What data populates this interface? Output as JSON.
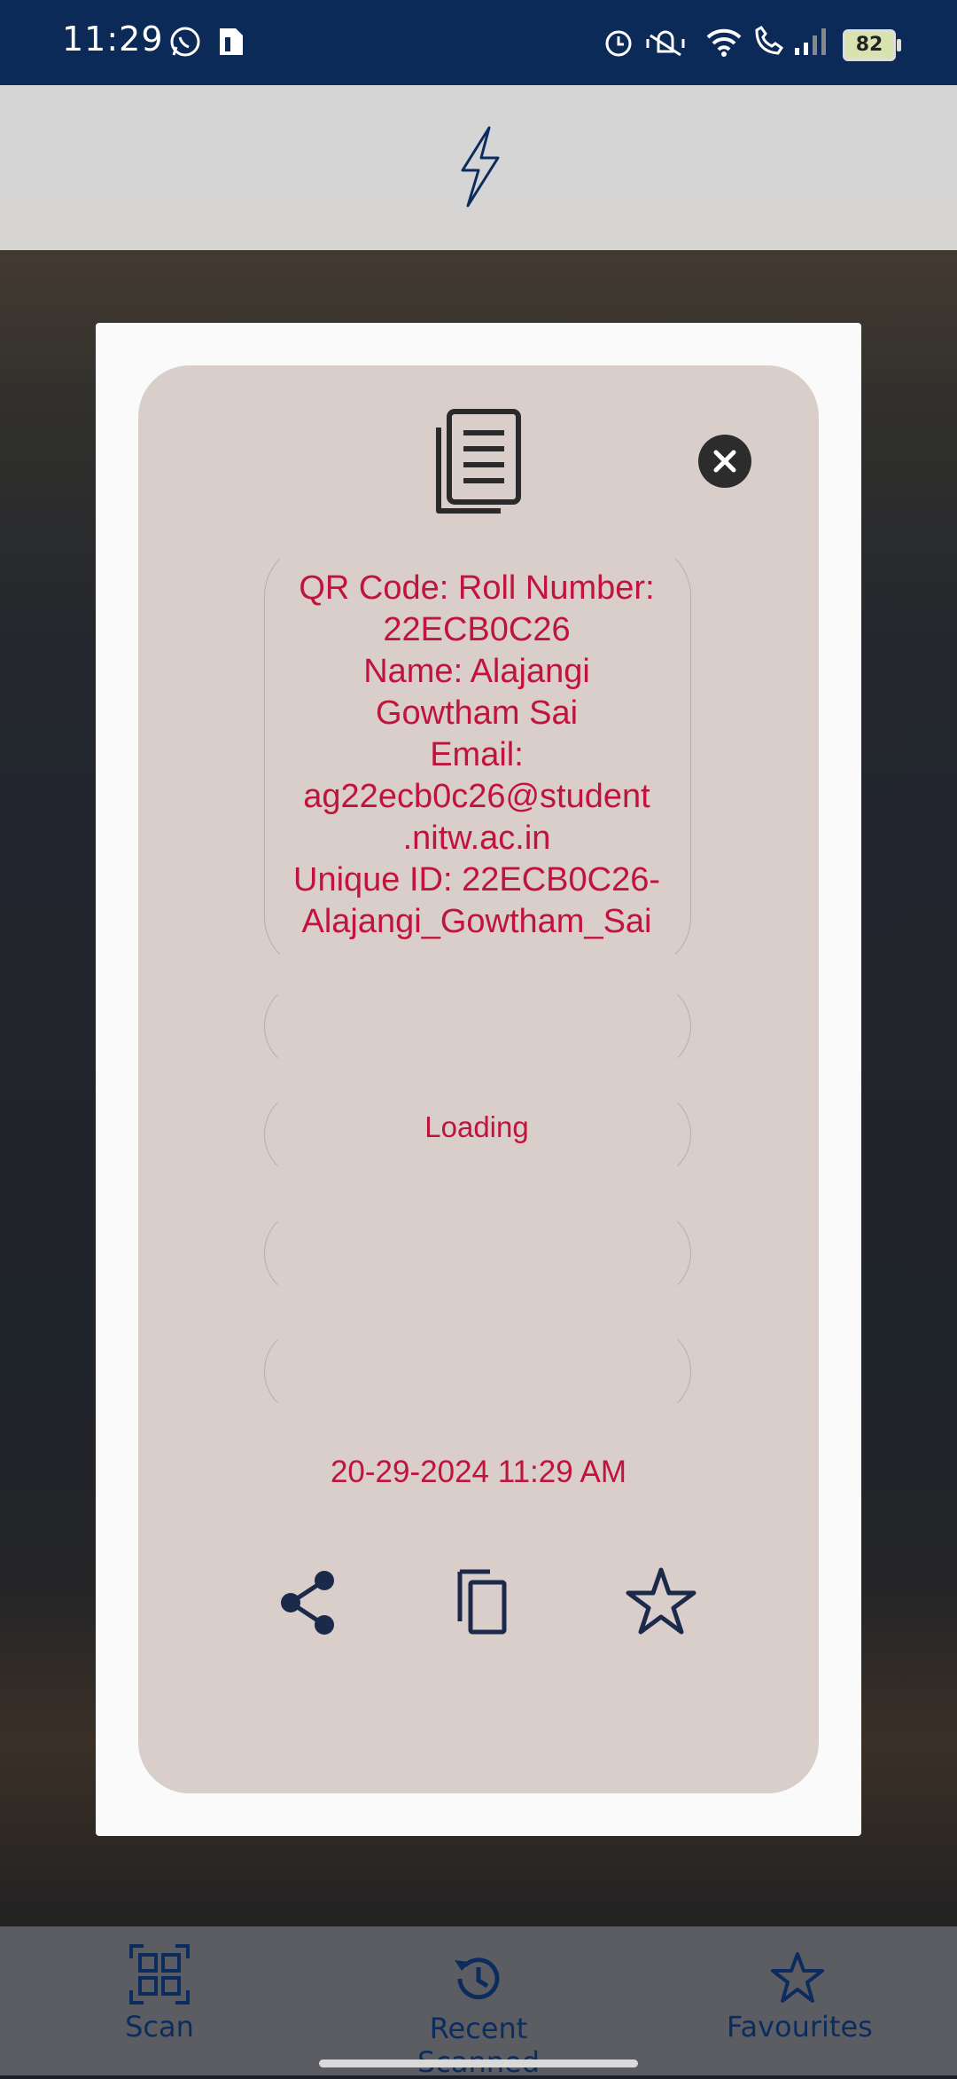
{
  "status_bar": {
    "time": "11:29",
    "battery_level": "82",
    "icons": [
      "whatsapp-icon",
      "sim-icon",
      "alarm-icon",
      "vibrate-icon",
      "wifi-icon",
      "wifi-call-icon",
      "signal-icon",
      "battery-icon"
    ]
  },
  "scanner": {
    "flash_icon": "flash-icon"
  },
  "dialog": {
    "copy_doc_icon": "document-copy-icon",
    "close_icon": "close-icon",
    "result_lines": [
      "QR Code: Roll Number:",
      "22ECB0C26",
      "Name: Alajangi",
      "Gowtham Sai",
      "Email:",
      "ag22ecb0c26@student",
      ".nitw.ac.in",
      "Unique ID: 22ECB0C26-",
      "Alajangi_Gowtham_Sai"
    ],
    "loading_text": "Loading",
    "timestamp": "20-29-2024 11:29 AM",
    "actions": [
      "share-icon",
      "copy-icon",
      "star-icon"
    ]
  },
  "bottom_nav": {
    "items": [
      {
        "label": "Scan",
        "icon": "qr-scan-icon"
      },
      {
        "label": "Recent Scanned",
        "icon": "history-icon"
      },
      {
        "label": "Favourites",
        "icon": "star-icon"
      }
    ]
  },
  "colors": {
    "status_bar": "#0b2a57",
    "card_bg": "#d9ceca",
    "result_text": "#c0143c",
    "nav_accent": "#0c2c5e"
  }
}
